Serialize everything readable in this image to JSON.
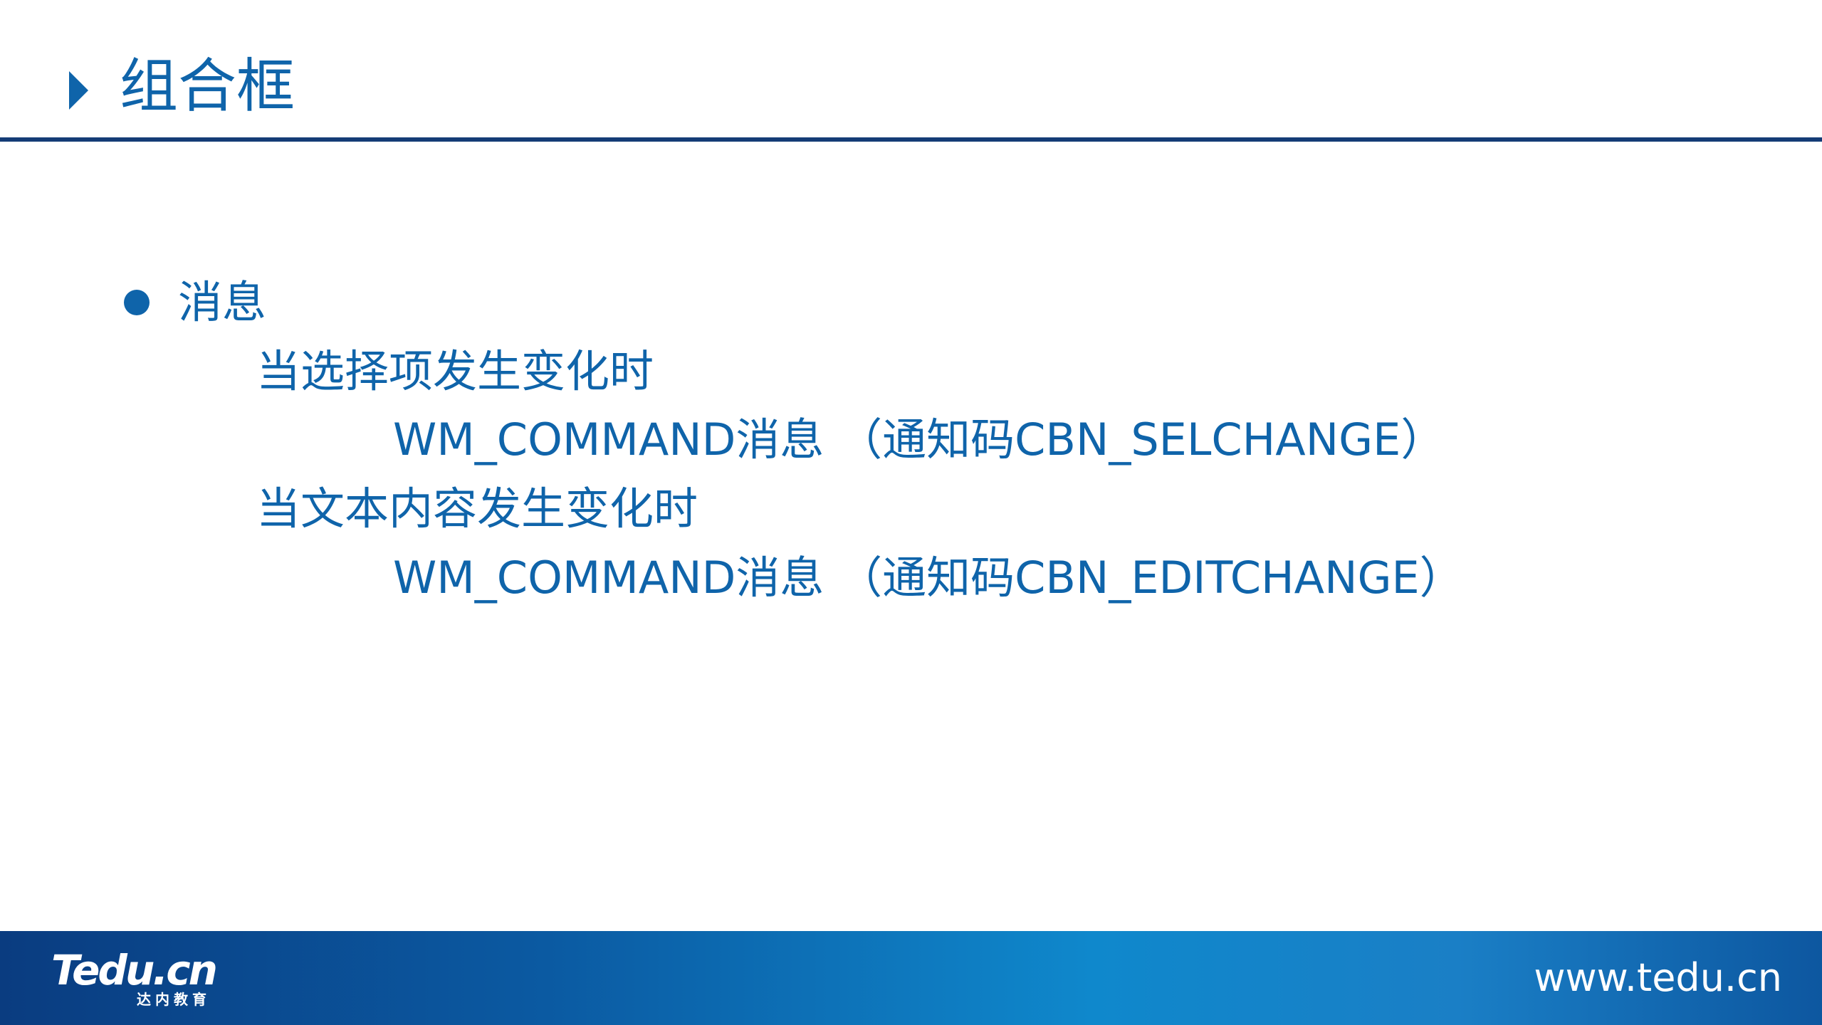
{
  "slide": {
    "title": "组合框",
    "bullets": [
      {
        "text": "消息"
      },
      {
        "text": "当选择项发生变化时"
      },
      {
        "text": "WM_COMMAND消息 （通知码CBN_SELCHANGE）"
      },
      {
        "text": "当文本内容发生变化时"
      },
      {
        "text": "WM_COMMAND消息 （通知码CBN_EDITCHANGE）"
      }
    ]
  },
  "footer": {
    "logo_text": "Tedu.cn",
    "logo_subtext": "达内教育",
    "url": "www.tedu.cn"
  },
  "colors": {
    "accent": "#0f64aa",
    "header_rule": "#143c76",
    "footer_start": "#0a3c80",
    "footer_mid": "#0f88cc"
  },
  "icons": {
    "title_marker": "triangle-right-icon",
    "bullet": "bullet-dot-icon"
  }
}
